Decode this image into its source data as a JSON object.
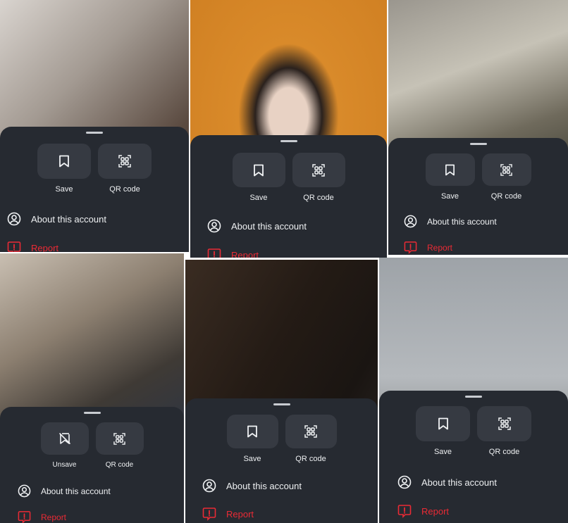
{
  "panels": [
    {
      "save_label": "Save",
      "qr_label": "QR code",
      "about_label": "About this account",
      "report_label": "Report",
      "bg": "#7d7570"
    },
    {
      "save_label": "Save",
      "qr_label": "QR code",
      "about_label": "About this account",
      "report_label": "Report",
      "bg": "#d98a2a"
    },
    {
      "save_label": "Save",
      "qr_label": "QR code",
      "about_label": "About this account",
      "report_label": "Report",
      "bg": "#8a8578"
    },
    {
      "save_label": "Unsave",
      "qr_label": "QR code",
      "about_label": "About this account",
      "report_label": "Report",
      "bg": "#6b6258"
    },
    {
      "save_label": "Save",
      "qr_label": "QR code",
      "about_label": "About this account",
      "report_label": "Report",
      "bg": "#2a221c"
    },
    {
      "save_label": "Save",
      "qr_label": "QR code",
      "about_label": "About this account",
      "report_label": "Report",
      "bg": "#a7adb3"
    }
  ],
  "colors": {
    "sheet": "#262a31",
    "button": "#363a42",
    "report": "#ea2a35",
    "text": "#eef0f2"
  },
  "icons": {
    "save": "bookmark-icon",
    "unsave": "bookmark-slash-icon",
    "qr": "qr-code-icon",
    "about": "account-circle-icon",
    "report": "report-icon"
  }
}
